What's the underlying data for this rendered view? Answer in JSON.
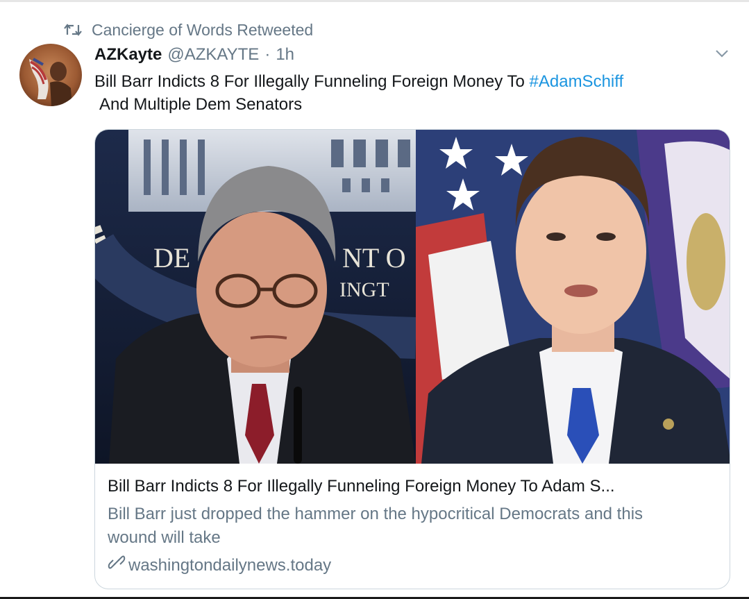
{
  "retweet": {
    "icon": "retweet-icon",
    "text": "Cancierge of Words Retweeted"
  },
  "tweet": {
    "display_name": "AZKayte",
    "handle": "@AZKAYTE",
    "separator": "·",
    "time": "1h",
    "text_line1": "Bill Barr Indicts 8 For Illegally Funneling Foreign Money To ",
    "hashtag": "#AdamSchiff",
    "text_line2": "And Multiple Dem Senators",
    "caret_icon": "chevron-down-icon",
    "hashtag_color": "#1b95e0"
  },
  "card": {
    "image_left_sign_text1": "DE",
    "image_left_sign_text2": "NT O",
    "image_left_sign_text3": "INGT",
    "title": "Bill Barr Indicts 8 For Illegally Funneling Foreign Money To Adam S...",
    "description": "Bill Barr just dropped the hammer on the hypocritical Democrats and this wound will take",
    "link_icon": "link-icon",
    "domain": "washingtondailynews.today"
  },
  "colors": {
    "secondary_text": "#657786",
    "primary_text": "#14171a",
    "border": "#ccd6dd"
  }
}
